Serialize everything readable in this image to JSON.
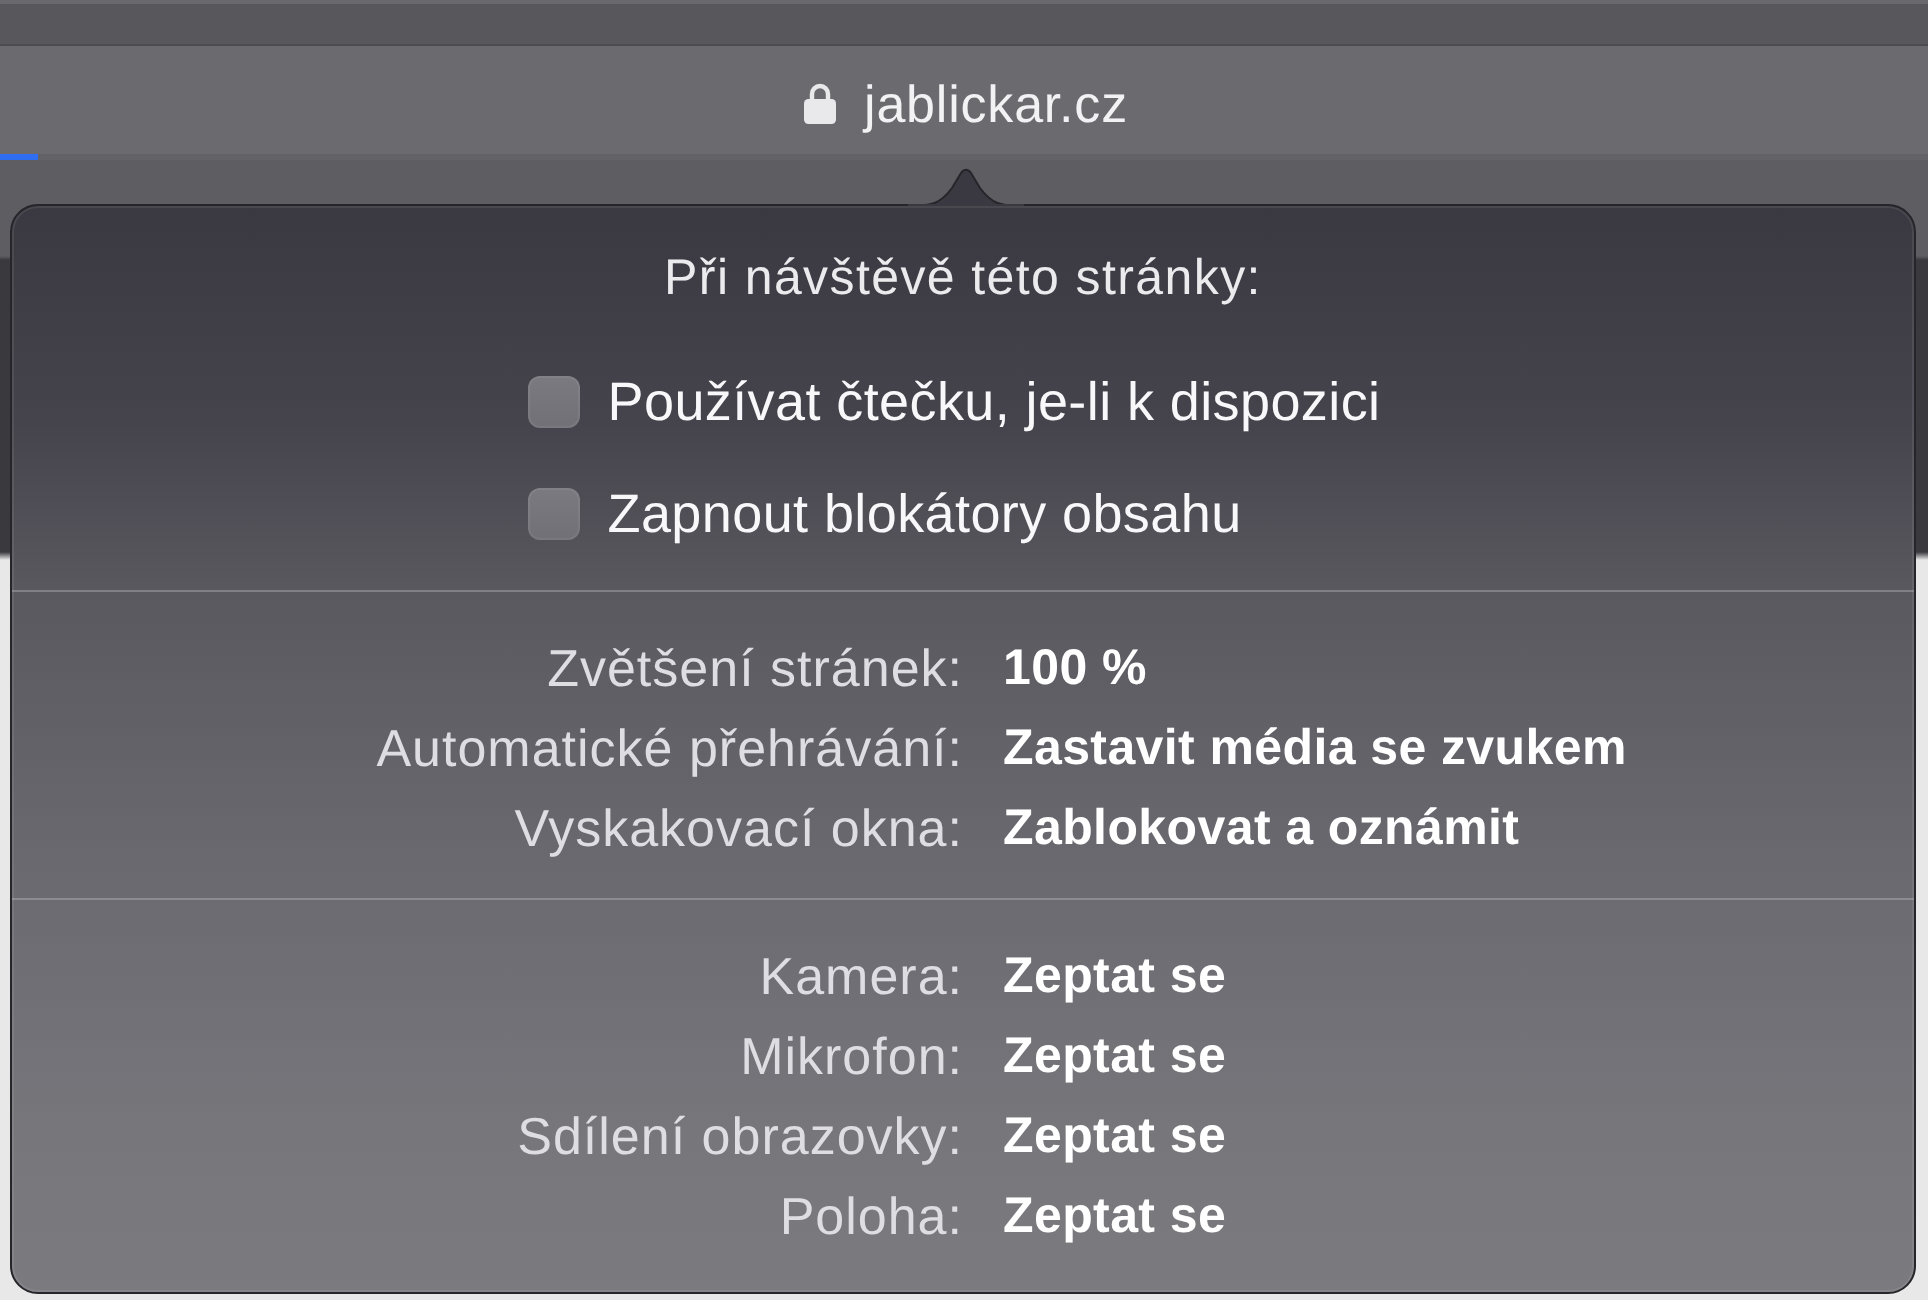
{
  "address_bar": {
    "url": "jablickar.cz",
    "secure": true,
    "load_progress": {
      "level": 0.02
    }
  },
  "site_settings": {
    "title": "Při návštěvě této stránky:",
    "options": [
      {
        "label": "Používat čtečku, je-li k dispozici",
        "checked": false
      },
      {
        "label": "Zapnout blokátory obsahu",
        "checked": false
      }
    ],
    "sections": [
      {
        "rows": [
          {
            "label": "Zvětšení stránek:",
            "value": "100 %"
          },
          {
            "label": "Automatické přehrávání:",
            "value": "Zastavit média se zvukem"
          },
          {
            "label": "Vyskakovací okna:",
            "value": "Zablokovat a oznámit"
          }
        ]
      },
      {
        "rows": [
          {
            "label": "Kamera:",
            "value": "Zeptat se"
          },
          {
            "label": "Mikrofon:",
            "value": "Zeptat se"
          },
          {
            "label": "Sdílení obrazovky:",
            "value": "Zeptat se"
          },
          {
            "label": "Poloha:",
            "value": "Zeptat se"
          }
        ]
      }
    ]
  }
}
